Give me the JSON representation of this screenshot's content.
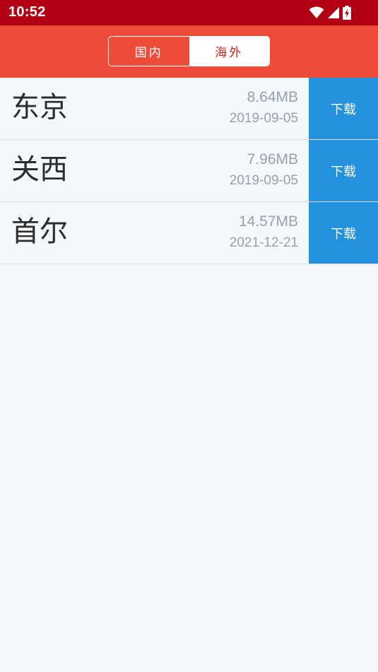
{
  "status_bar": {
    "time": "10:52",
    "icons": [
      "wifi-icon",
      "cell-signal-icon",
      "battery-charging-icon"
    ]
  },
  "header": {
    "tabs": [
      {
        "label": "国内",
        "active": false
      },
      {
        "label": "海外",
        "active": true
      }
    ]
  },
  "list": {
    "items": [
      {
        "name": "东京",
        "size": "8.64MB",
        "date": "2019-09-05",
        "button": "下载"
      },
      {
        "name": "关西",
        "size": "7.96MB",
        "date": "2019-09-05",
        "button": "下载"
      },
      {
        "name": "首尔",
        "size": "14.57MB",
        "date": "2021-12-21",
        "button": "下载"
      }
    ]
  },
  "colors": {
    "status_bar": "#b00012",
    "header": "#ec4c38",
    "download_button": "#2391de",
    "background": "#f4f8fa",
    "active_tab_text": "#c8241a"
  }
}
